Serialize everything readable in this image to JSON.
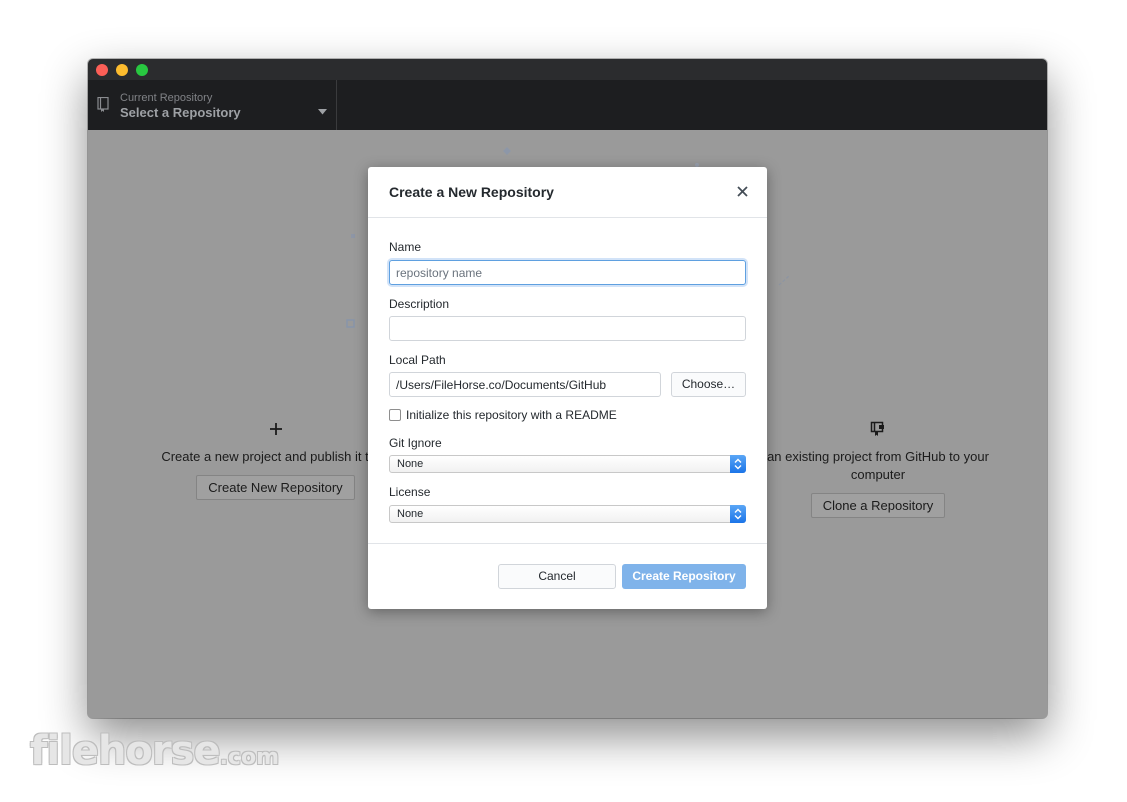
{
  "titlebar": {},
  "toolbar": {
    "repo_picker": {
      "caption": "Current Repository",
      "title": "Select a Repository",
      "icon": "repo-icon"
    }
  },
  "background": {
    "create_option": {
      "icon": "plus-icon",
      "text": "Create a new project and publish it to G",
      "button": "Create New Repository"
    },
    "clone_option": {
      "icon": "clone-icon",
      "text_line1": "an existing project from GitHub to your",
      "text_line2": "computer",
      "button": "Clone a Repository"
    }
  },
  "dialog": {
    "title": "Create a New Repository",
    "name_label": "Name",
    "name_placeholder": "repository name",
    "description_label": "Description",
    "description_value": "",
    "local_path_label": "Local Path",
    "local_path_value": "/Users/FileHorse.co/Documents/GitHub",
    "choose_button": "Choose…",
    "readme_checkbox_label": "Initialize this repository with a README",
    "readme_checked": false,
    "gitignore_label": "Git Ignore",
    "gitignore_value": "None",
    "license_label": "License",
    "license_value": "None",
    "cancel_button": "Cancel",
    "create_button": "Create Repository",
    "create_button_color": "#7fb3ea"
  },
  "watermark": {
    "text": "filehorse",
    "suffix": ".com"
  }
}
